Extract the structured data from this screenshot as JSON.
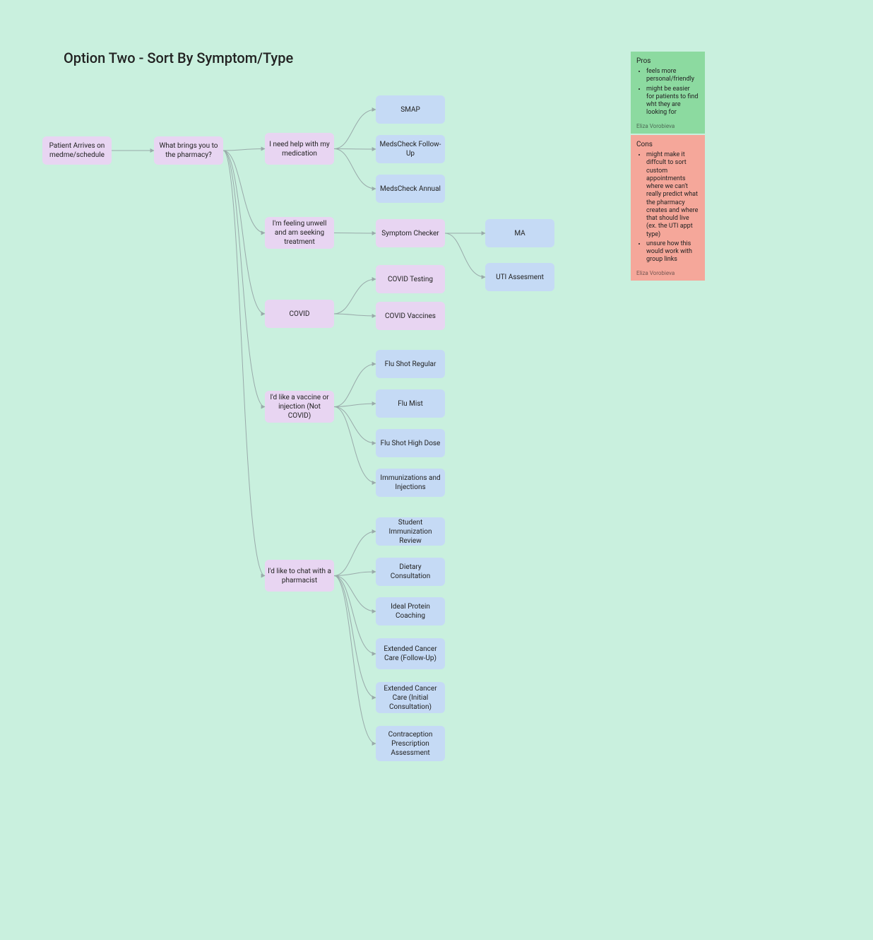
{
  "title": "Option Two - Sort By Symptom/Type",
  "nodes": {
    "patient": "Patient Arrives on medme/schedule",
    "whatBrings": "What brings you to the pharmacy?",
    "needMed": "I need help with my medication",
    "smap": "SMAP",
    "medFollow": "MedsCheck Follow-Up",
    "medAnnual": "MedsCheck Annual",
    "feelUnwell": "I'm feeling unwell and am seeking treatment",
    "symptomChk": "Symptom Checker",
    "ma": "MA",
    "uti": "UTI Assesment",
    "covid": "COVID",
    "covidTest": "COVID Testing",
    "covidVax": "COVID Vaccines",
    "vaccine": "I'd like a vaccine or injection (Not COVID)",
    "fluReg": "Flu Shot Regular",
    "fluMist": "Flu Mist",
    "fluHigh": "Flu Shot High Dose",
    "immun": "Immunizations and Injections",
    "chat": "I'd like to chat with a pharmacist",
    "student": "Student Immunization Review",
    "diet": "Dietary Consultation",
    "protein": "Ideal Protein Coaching",
    "cancerFU": "Extended Cancer Care (Follow-Up)",
    "cancerInit": "Extended Cancer Care (Initial Consultation)",
    "contra": "Contraception Prescription Assessment"
  },
  "pros": {
    "title": "Pros",
    "items": [
      "feels more personal/friendly",
      "might be easier for patients to find wht they are looking for"
    ],
    "author": "Eliza Vorobieva"
  },
  "cons": {
    "title": "Cons",
    "items": [
      "might make it diffcult to sort custom appointments where we can't really predict what the pharmacy creates and where that should live (ex. the UTI appt type)",
      "unsure how this would work with group links"
    ],
    "author": "Eliza Vorobieva"
  },
  "chart_data": {
    "type": "flowchart",
    "edges": [
      [
        "patient",
        "whatBrings"
      ],
      [
        "whatBrings",
        "needMed"
      ],
      [
        "needMed",
        "smap"
      ],
      [
        "needMed",
        "medFollow"
      ],
      [
        "needMed",
        "medAnnual"
      ],
      [
        "whatBrings",
        "feelUnwell"
      ],
      [
        "feelUnwell",
        "symptomChk"
      ],
      [
        "symptomChk",
        "ma"
      ],
      [
        "symptomChk",
        "uti"
      ],
      [
        "whatBrings",
        "covid"
      ],
      [
        "covid",
        "covidTest"
      ],
      [
        "covid",
        "covidVax"
      ],
      [
        "whatBrings",
        "vaccine"
      ],
      [
        "vaccine",
        "fluReg"
      ],
      [
        "vaccine",
        "fluMist"
      ],
      [
        "vaccine",
        "fluHigh"
      ],
      [
        "vaccine",
        "immun"
      ],
      [
        "whatBrings",
        "chat"
      ],
      [
        "chat",
        "student"
      ],
      [
        "chat",
        "diet"
      ],
      [
        "chat",
        "protein"
      ],
      [
        "chat",
        "cancerFU"
      ],
      [
        "chat",
        "cancerInit"
      ],
      [
        "chat",
        "contra"
      ]
    ]
  }
}
